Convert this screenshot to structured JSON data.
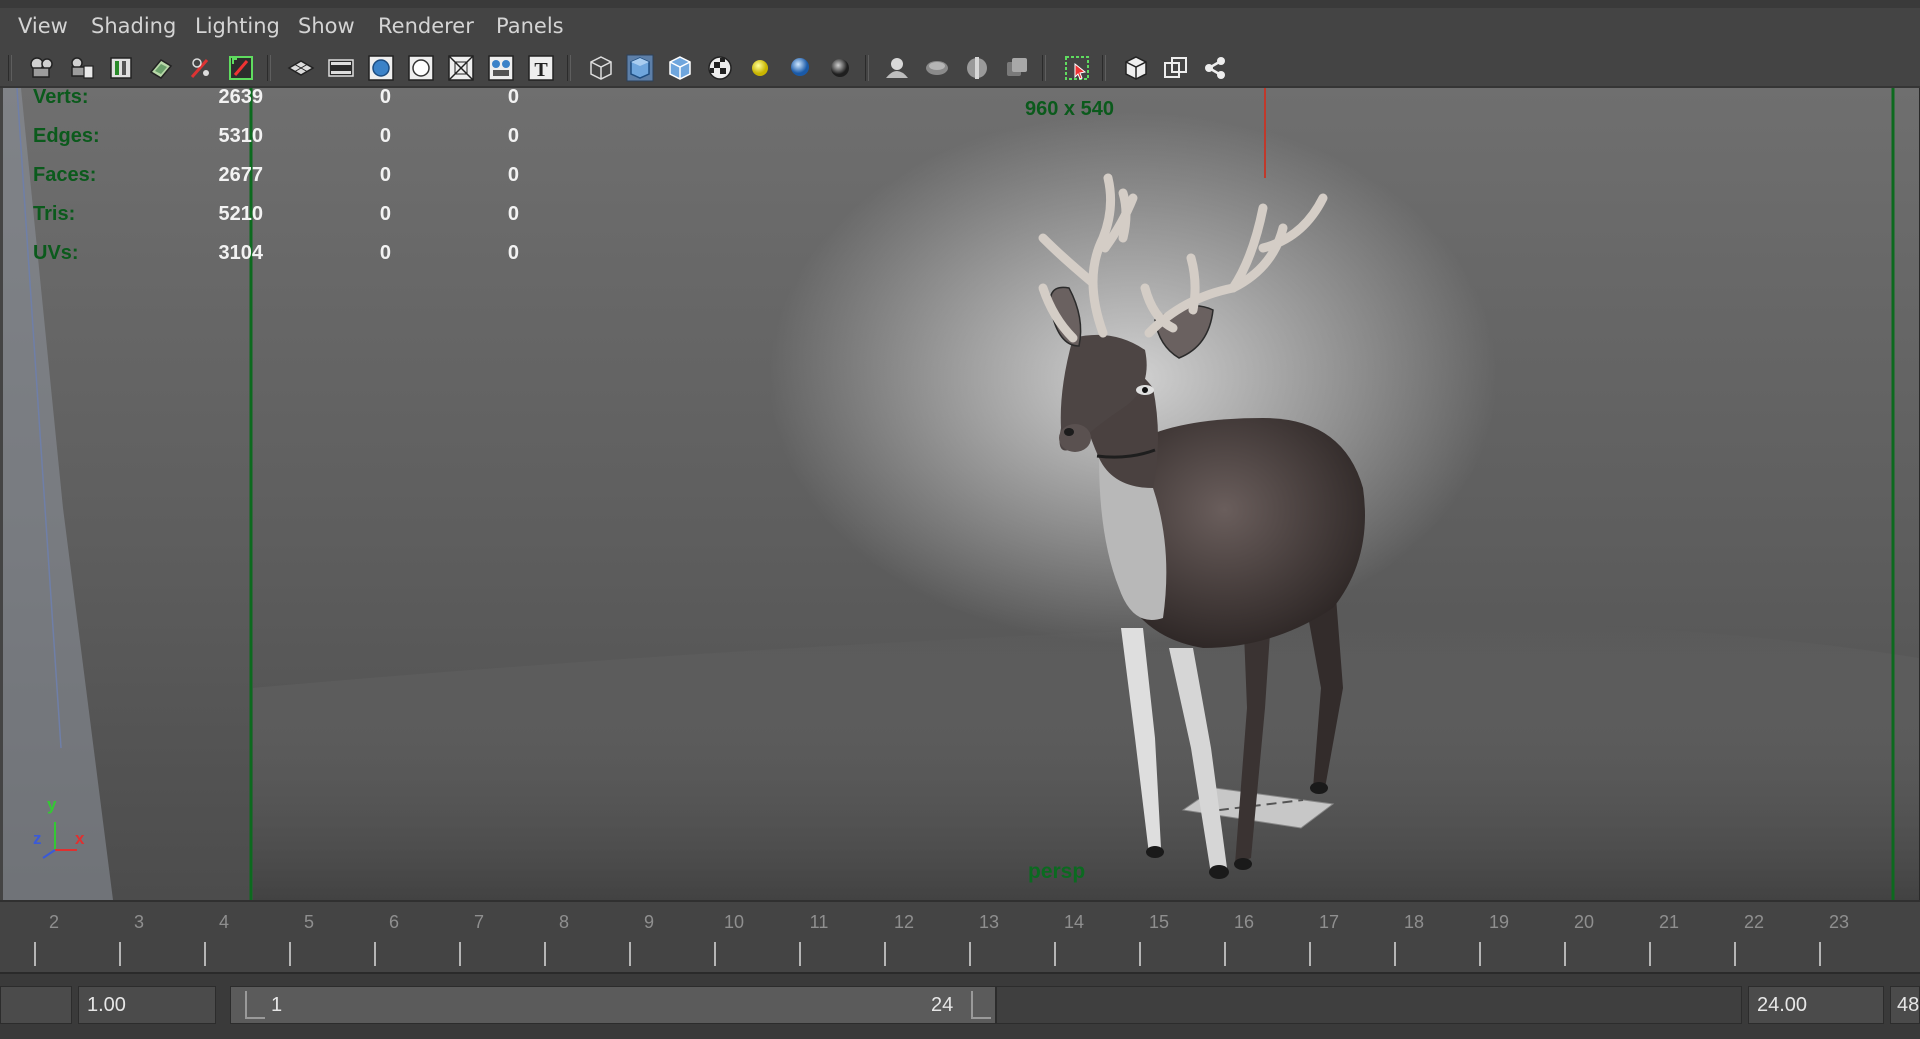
{
  "menu": {
    "items": [
      {
        "label": "View"
      },
      {
        "label": "Shading"
      },
      {
        "label": "Lighting"
      },
      {
        "label": "Show"
      },
      {
        "label": "Renderer"
      },
      {
        "label": "Panels"
      }
    ]
  },
  "toolbar": {
    "icons": [
      "select-camera-icon",
      "camera-attributes-icon",
      "bookmark-icon",
      "image-plane-icon",
      "grease-pencil-icon",
      "two-d-pan-zoom-icon",
      "grid-icon",
      "film-gate-icon",
      "resolution-gate-icon",
      "gate-mask-icon",
      "field-chart-icon",
      "safe-action-icon",
      "safe-title-icon",
      "wireframe-icon",
      "smooth-shade-icon",
      "wireframe-on-shaded-icon",
      "textured-icon",
      "use-all-lights-icon",
      "shadows-icon",
      "screen-space-ao-icon",
      "motion-blur-icon",
      "multisample-aa-icon",
      "depth-of-field-icon",
      "isolate-select-icon",
      "xray-icon",
      "xray-joints-icon",
      "xray-active-icon"
    ]
  },
  "hud": {
    "rows": [
      {
        "label": "Verts:",
        "v1": "2639",
        "v2": "0",
        "v3": "0"
      },
      {
        "label": "Edges:",
        "v1": "5310",
        "v2": "0",
        "v3": "0"
      },
      {
        "label": "Faces:",
        "v1": "2677",
        "v2": "0",
        "v3": "0"
      },
      {
        "label": "Tris:",
        "v1": "5210",
        "v2": "0",
        "v3": "0"
      },
      {
        "label": "UVs:",
        "v1": "3104",
        "v2": "0",
        "v3": "0"
      }
    ],
    "resolution": "960 x 540",
    "camera": "persp",
    "axis": {
      "y": "y",
      "z": "z",
      "x": "x"
    }
  },
  "timeline": {
    "frames": [
      "2",
      "3",
      "4",
      "5",
      "6",
      "7",
      "8",
      "9",
      "10",
      "11",
      "12",
      "13",
      "14",
      "15",
      "16",
      "17",
      "18",
      "19",
      "20",
      "21",
      "22",
      "23"
    ]
  },
  "range": {
    "start_time": "1.00",
    "range_start": "1",
    "range_end": "24",
    "end_time": "24.00",
    "max_end_partial": "48"
  },
  "colors": {
    "hud_label": "#0b5a1c",
    "hud_value": "#f2f2f2",
    "background": "#444444"
  }
}
